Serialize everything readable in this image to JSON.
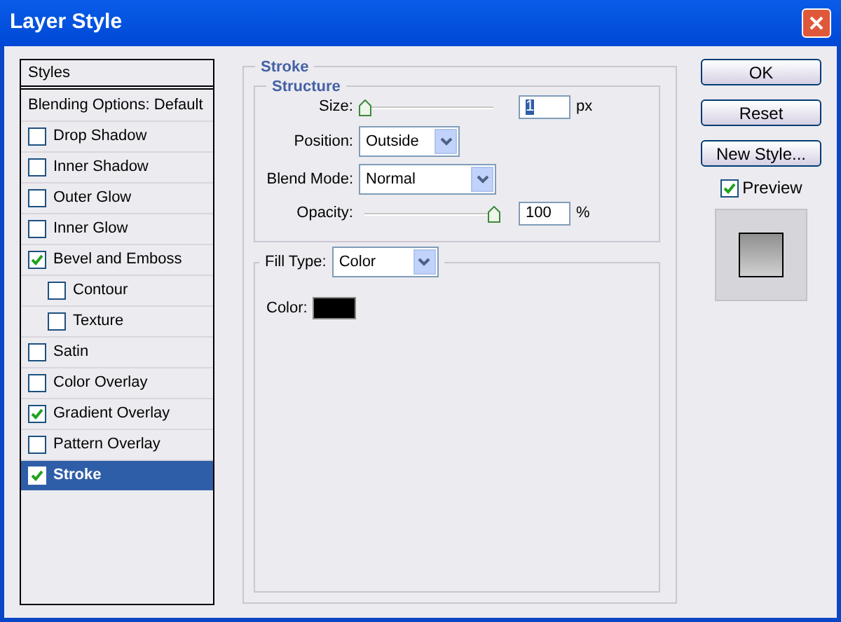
{
  "window": {
    "title": "Layer Style"
  },
  "styles_list": {
    "header": "Styles",
    "blending": "Blending Options: Default",
    "items": [
      {
        "label": "Drop Shadow",
        "checked": false,
        "selected": false
      },
      {
        "label": "Inner Shadow",
        "checked": false,
        "selected": false
      },
      {
        "label": "Outer Glow",
        "checked": false,
        "selected": false
      },
      {
        "label": "Inner Glow",
        "checked": false,
        "selected": false
      },
      {
        "label": "Bevel and Emboss",
        "checked": true,
        "selected": false,
        "children": [
          {
            "label": "Contour",
            "checked": false,
            "selected": false
          },
          {
            "label": "Texture",
            "checked": false,
            "selected": false
          }
        ]
      },
      {
        "label": "Satin",
        "checked": false,
        "selected": false
      },
      {
        "label": "Color Overlay",
        "checked": false,
        "selected": false
      },
      {
        "label": "Gradient Overlay",
        "checked": true,
        "selected": false
      },
      {
        "label": "Pattern Overlay",
        "checked": false,
        "selected": false
      },
      {
        "label": "Stroke",
        "checked": true,
        "selected": true
      }
    ]
  },
  "stroke": {
    "title": "Stroke",
    "structure": {
      "title": "Structure",
      "size": {
        "label": "Size:",
        "level": 0,
        "value": "1",
        "unit": "px"
      },
      "position": {
        "label": "Position:",
        "value": "Outside"
      },
      "blend_mode": {
        "label": "Blend Mode:",
        "value": "Normal"
      },
      "opacity": {
        "label": "Opacity:",
        "level": 1,
        "value": "100",
        "unit": "%"
      }
    },
    "fill_type": {
      "label": "Fill Type:",
      "value": "Color",
      "color_label": "Color:",
      "color": "#000000"
    }
  },
  "buttons": [
    "OK",
    "Reset",
    "New Style..."
  ],
  "preview": {
    "label": "Preview",
    "checked": true
  }
}
